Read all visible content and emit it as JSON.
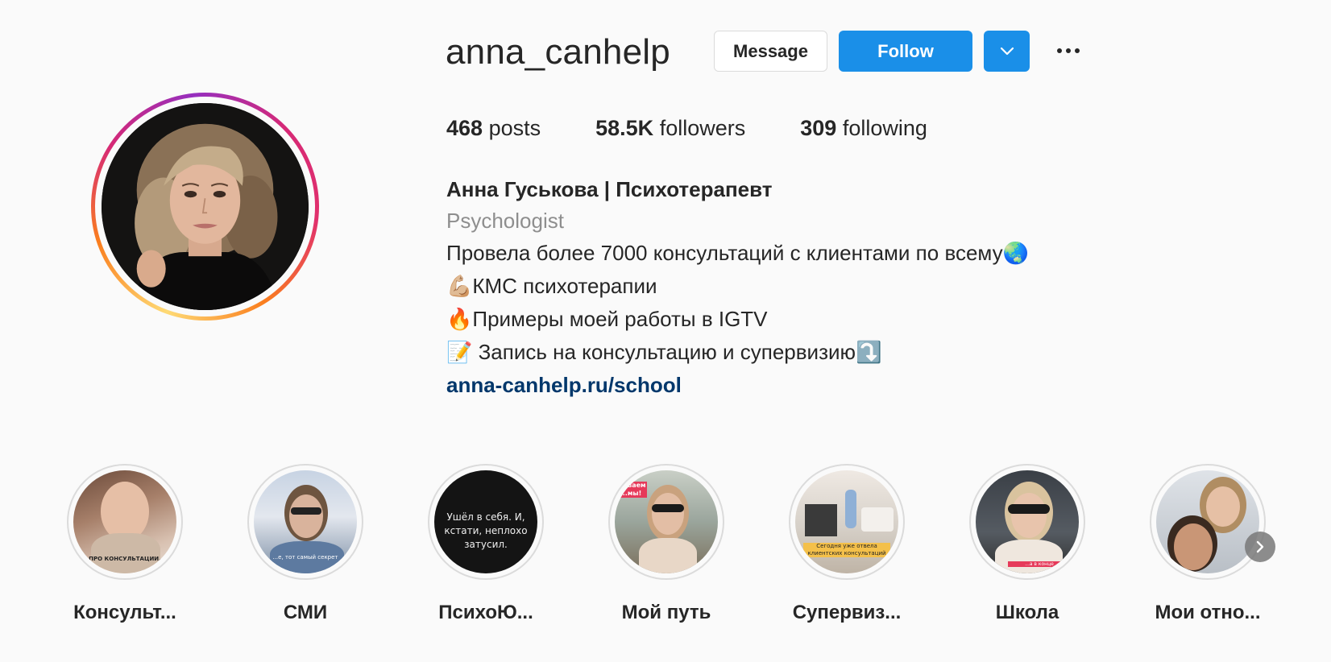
{
  "profile": {
    "username": "anna_canhelp",
    "buttons": {
      "message": "Message",
      "follow": "Follow"
    },
    "stats": {
      "posts_count": "468",
      "posts_label": "posts",
      "followers_count": "58.5K",
      "followers_label": "followers",
      "following_count": "309",
      "following_label": "following"
    },
    "bio": {
      "name": "Анна Гуськова | Психотерапевт",
      "category": "Psychologist",
      "lines": [
        {
          "emoji_before": "",
          "text": "Провела более 7000 консультаций с клиентами по всему",
          "emoji_after": "🌏"
        },
        {
          "emoji_before": "💪🏼",
          "text": "КМС психотерапии",
          "emoji_after": ""
        },
        {
          "emoji_before": "🔥",
          "text": "Примеры моей работы в IGTV",
          "emoji_after": ""
        },
        {
          "emoji_before": "📝",
          "text": " Запись на консультацию и супервизию",
          "emoji_after": "⤵️"
        }
      ],
      "link": "anna-canhelp.ru/school"
    }
  },
  "highlights": [
    {
      "label": "Консульт...",
      "caption": "ПРО КОНСУЛЬТАЦИИ."
    },
    {
      "label": "СМИ",
      "caption": "...е, тот самый секрет"
    },
    {
      "label": "ПсихоЮ...",
      "caption": "Ушёл в себя. И, кстати, неплохо затусил."
    },
    {
      "label": "Мой путь",
      "caption": "...иваем ...мы!"
    },
    {
      "label": "Супервиз...",
      "caption": "Сегодня уже отвела клиентских консультаций"
    },
    {
      "label": "Школа",
      "caption": "...а в конце"
    },
    {
      "label": "Мои отно...",
      "caption": ""
    }
  ],
  "icons": {
    "more": "more-horizontal-icon",
    "dropdown": "chevron-down-icon",
    "next": "chevron-right-icon"
  },
  "colors": {
    "follow_button": "#1a8fe8",
    "link": "#00376b",
    "muted": "#8e8e8e"
  }
}
